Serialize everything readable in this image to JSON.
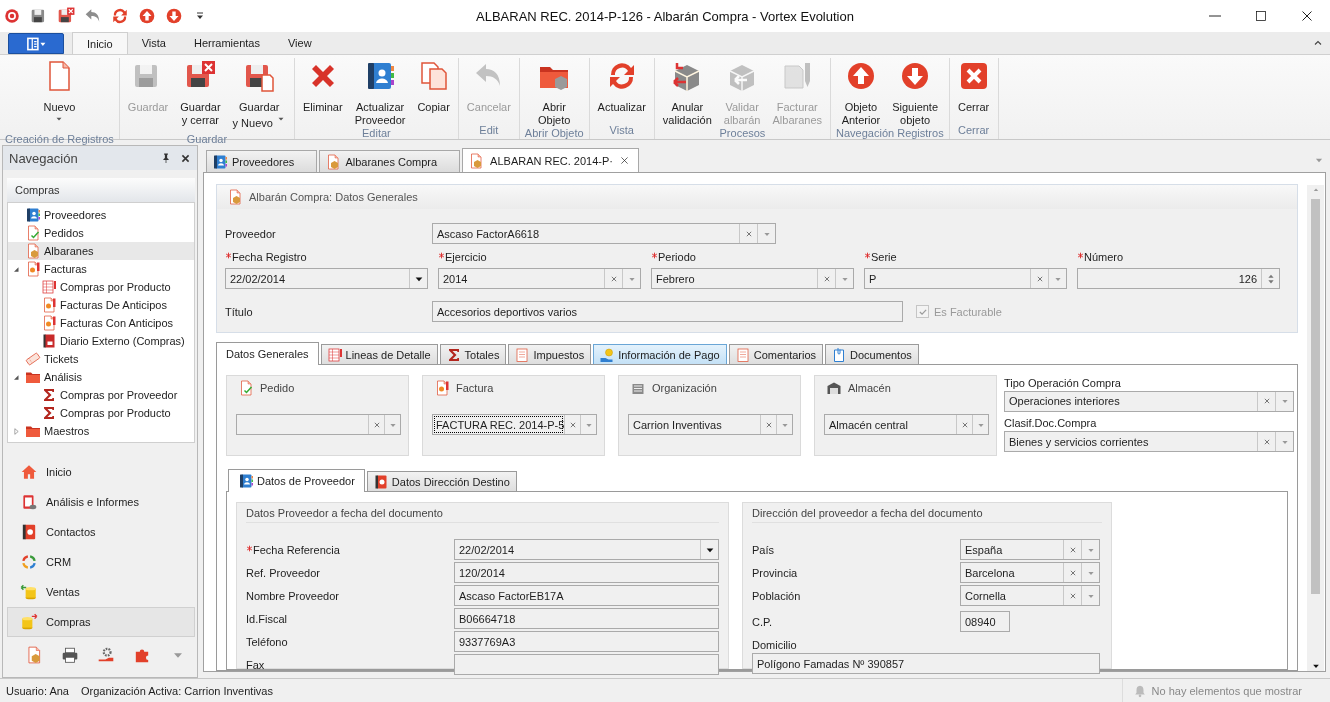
{
  "window": {
    "title": "ALBARAN REC. 2014-P-126 - Albarán Compra - Vortex Evolution"
  },
  "ribbon": {
    "tabs": [
      {
        "label": "Inicio",
        "selected": true
      },
      {
        "label": "Vista",
        "selected": false
      },
      {
        "label": "Herramientas",
        "selected": false
      },
      {
        "label": "View",
        "selected": false
      }
    ],
    "groups": [
      {
        "label": "Creación de Registros",
        "buttons": [
          {
            "lines": [
              "Nuevo"
            ],
            "disabled": false,
            "dropdown": true
          }
        ]
      },
      {
        "label": "Guardar",
        "buttons": [
          {
            "lines": [
              "Guardar"
            ],
            "disabled": true,
            "dropdown": false
          },
          {
            "lines": [
              "Guardar",
              "y cerrar"
            ],
            "disabled": false,
            "dropdown": false
          },
          {
            "lines": [
              "Guardar",
              "y Nuevo"
            ],
            "disabled": false,
            "dropdown": true
          }
        ]
      },
      {
        "label": "Editar",
        "buttons": [
          {
            "lines": [
              "Eliminar"
            ],
            "disabled": false,
            "dropdown": false
          },
          {
            "lines": [
              "Actualizar",
              "Proveedor"
            ],
            "disabled": false,
            "dropdown": false
          },
          {
            "lines": [
              "Copiar"
            ],
            "disabled": false,
            "dropdown": false
          }
        ]
      },
      {
        "label": "Edit",
        "buttons": [
          {
            "lines": [
              "Cancelar"
            ],
            "disabled": true,
            "dropdown": false
          }
        ]
      },
      {
        "label": "Abrir Objeto",
        "buttons": [
          {
            "lines": [
              "Abrir",
              "Objeto"
            ],
            "disabled": false,
            "dropdown": false
          }
        ]
      },
      {
        "label": "Vista",
        "buttons": [
          {
            "lines": [
              "Actualizar"
            ],
            "disabled": false,
            "dropdown": false
          }
        ]
      },
      {
        "label": "Procesos",
        "buttons": [
          {
            "lines": [
              "Anular",
              "validación"
            ],
            "disabled": false,
            "dropdown": false
          },
          {
            "lines": [
              "Validar",
              "albarán"
            ],
            "disabled": true,
            "dropdown": false
          },
          {
            "lines": [
              "Facturar",
              "Albaranes"
            ],
            "disabled": true,
            "dropdown": false
          }
        ]
      },
      {
        "label": "Navegación Registros",
        "buttons": [
          {
            "lines": [
              "Objeto",
              "Anterior"
            ],
            "disabled": false,
            "dropdown": false
          },
          {
            "lines": [
              "Siguiente",
              "objeto"
            ],
            "disabled": false,
            "dropdown": false
          }
        ]
      },
      {
        "label": "Cerrar",
        "buttons": [
          {
            "lines": [
              "Cerrar"
            ],
            "disabled": false,
            "dropdown": false
          }
        ]
      }
    ]
  },
  "navigation": {
    "title": "Navegación",
    "section": "Compras",
    "tree": [
      {
        "label": "Proveedores",
        "selected": false
      },
      {
        "label": "Pedidos",
        "selected": false
      },
      {
        "label": "Albaranes",
        "selected": true
      },
      {
        "label": "Facturas",
        "selected": false,
        "expanded": true,
        "children": [
          {
            "label": "Compras por Producto",
            "selected": false
          },
          {
            "label": "Facturas De Anticipos",
            "selected": false
          },
          {
            "label": "Facturas Con Anticipos",
            "selected": false
          },
          {
            "label": "Diario Externo (Compras)",
            "selected": false
          }
        ]
      },
      {
        "label": "Tickets",
        "selected": false
      },
      {
        "label": "Análisis",
        "selected": false,
        "expanded": true,
        "children": [
          {
            "label": "Compras por Proveedor",
            "selected": false
          },
          {
            "label": "Compras por Producto",
            "selected": false
          }
        ]
      },
      {
        "label": "Maestros",
        "selected": false,
        "expanded": false
      }
    ],
    "modules": [
      {
        "label": "Inicio",
        "selected": false
      },
      {
        "label": "Análisis e Informes",
        "selected": false
      },
      {
        "label": "Contactos",
        "selected": false
      },
      {
        "label": "CRM",
        "selected": false
      },
      {
        "label": "Ventas",
        "selected": false
      },
      {
        "label": "Compras",
        "selected": true
      }
    ]
  },
  "document_tabs": [
    {
      "label": "Proveedores",
      "selected": false
    },
    {
      "label": "Albaranes Compra",
      "selected": false
    },
    {
      "label": "ALBARAN REC. 2014-P·",
      "selected": true
    }
  ],
  "header": {
    "title": "Albarán Compra: Datos Generales",
    "fields": [
      {
        "label": "Proveedor",
        "kind": "combo",
        "value": "Ascaso FactorA6618",
        "required": false
      },
      {
        "label": "Fecha Registro",
        "kind": "date",
        "value": "22/02/2014",
        "required": true
      },
      {
        "label": "Ejercicio",
        "kind": "combo",
        "value": "2014",
        "required": true
      },
      {
        "label": "Periodo",
        "kind": "combo",
        "value": "Febrero",
        "required": true
      },
      {
        "label": "Serie",
        "kind": "combo",
        "value": "P",
        "required": true
      },
      {
        "label": "Número",
        "kind": "spin",
        "value": "126",
        "required": true
      },
      {
        "label": "Título",
        "kind": "text",
        "value": "Accesorios deportivos varios",
        "required": false
      },
      {
        "label": "Es Facturable",
        "kind": "checkbox",
        "checked": true,
        "disabled": true
      }
    ]
  },
  "detail_tabs": [
    {
      "label": "Datos Generales",
      "selected": true,
      "hovered": false
    },
    {
      "label": "Lineas de Detalle",
      "selected": false,
      "hovered": false
    },
    {
      "label": "Totales",
      "selected": false,
      "hovered": false
    },
    {
      "label": "Impuestos",
      "selected": false,
      "hovered": false
    },
    {
      "label": "Información de Pago",
      "selected": false,
      "hovered": true
    },
    {
      "label": "Comentarios",
      "selected": false,
      "hovered": false
    },
    {
      "label": "Documentos",
      "selected": false,
      "hovered": false
    }
  ],
  "general": {
    "groups": [
      {
        "title": "Pedido",
        "field": {
          "kind": "combo",
          "focused": false
        }
      },
      {
        "title": "Factura",
        "field": {
          "kind": "combo",
          "value": "FACTURA REC. 2014-P-5",
          "focused": true
        }
      },
      {
        "title": "Organización",
        "field": {
          "kind": "combo",
          "value": "Carrion Inventivas",
          "focused": false
        }
      },
      {
        "title": "Almacén",
        "field": {
          "kind": "combo",
          "value": "Almacén central",
          "focused": false
        }
      }
    ],
    "options": [
      {
        "label": "Tipo Operación Compra",
        "kind": "combo",
        "value": "Operaciones interiores"
      },
      {
        "label": "Clasif.Doc.Compra",
        "kind": "combo",
        "value": "Bienes y servicios corrientes"
      }
    ]
  },
  "sub_tabs": [
    {
      "label": "Datos de Proveedor",
      "selected": true
    },
    {
      "label": "Datos Dirección Destino",
      "selected": false
    }
  ],
  "supplier_panel": {
    "title": "Datos Proveedor a fecha del documento",
    "fields": [
      {
        "label": "Fecha Referencia",
        "kind": "date",
        "value": "22/02/2014",
        "required": true
      },
      {
        "label": "Ref. Proveedor",
        "kind": "text",
        "value": "120/2014",
        "required": false
      },
      {
        "label": "Nombre Proveedor",
        "kind": "text",
        "value": "Ascaso FactorEB17A",
        "required": false
      },
      {
        "label": "Id.Fiscal",
        "kind": "text",
        "value": "B06664718",
        "required": false
      },
      {
        "label": "Teléfono",
        "kind": "text",
        "value": "9337769A3",
        "required": false
      },
      {
        "label": "Fax",
        "kind": "text",
        "required": false
      }
    ]
  },
  "address_panel": {
    "title": "Dirección del proveedor a fecha del documento",
    "fields": [
      {
        "label": "País",
        "kind": "combo",
        "value": "España"
      },
      {
        "label": "Provincia",
        "kind": "combo",
        "value": "Barcelona"
      },
      {
        "label": "Población",
        "kind": "combo",
        "value": "Cornella"
      },
      {
        "label": "C.P.",
        "kind": "short",
        "value": "08940"
      },
      {
        "label": "Domicilio",
        "kind": "wide",
        "value": "Polígono Famadas Nº 390857"
      }
    ]
  },
  "status_bar": {
    "user": "Usuario: Ana",
    "organization": "Organización Activa: Carrion Inventivas",
    "notifications": "No hay elementos que mostrar"
  }
}
